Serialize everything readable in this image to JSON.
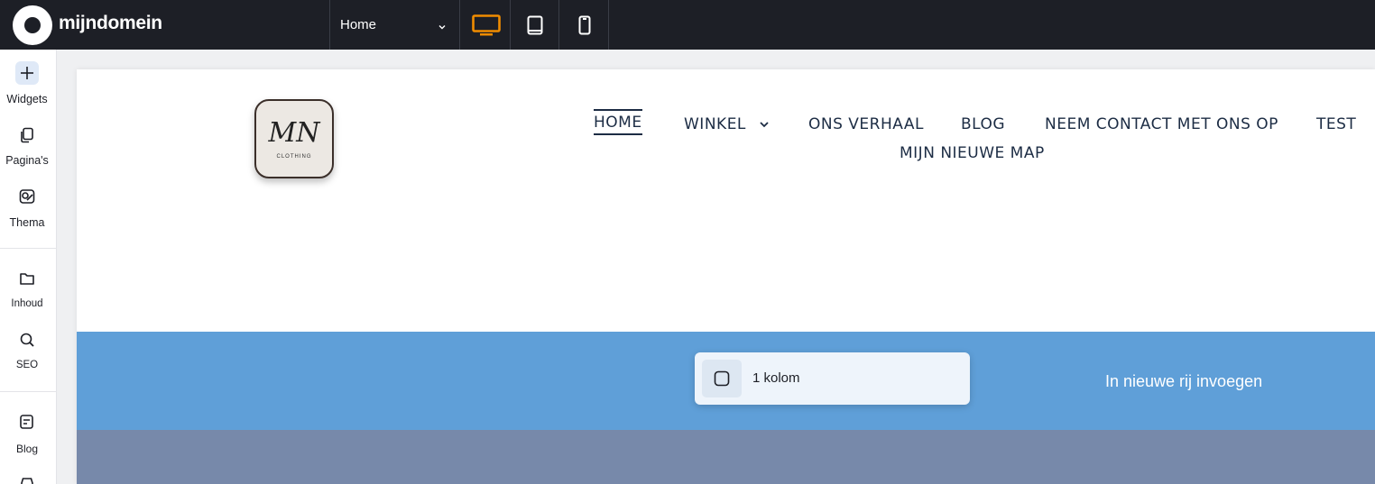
{
  "brand": {
    "name": "mijndomein"
  },
  "topbar": {
    "page_selector": {
      "value": "Home"
    },
    "devices": [
      {
        "name": "desktop",
        "active": true
      },
      {
        "name": "tablet",
        "active": false
      },
      {
        "name": "mobile",
        "active": false
      }
    ]
  },
  "sidebar": {
    "items": [
      {
        "label": "Widgets",
        "icon": "plus-icon"
      },
      {
        "label": "Pagina's",
        "icon": "pages-icon"
      },
      {
        "label": "Thema",
        "icon": "theme-icon"
      },
      {
        "label": "Inhoud",
        "icon": "folder-icon"
      },
      {
        "label": "SEO",
        "icon": "seo-search-icon"
      },
      {
        "label": "Blog",
        "icon": "blog-icon"
      }
    ]
  },
  "site": {
    "logo": {
      "monogram": "MN",
      "subtitle": "CLOTHING"
    },
    "nav": {
      "home": "HOME",
      "winkel": "WINKEL",
      "ons_verhaal": "ONS VERHAAL",
      "blog": "BLOG",
      "contact": "NEEM CONTACT MET ONS OP",
      "test": "TEST",
      "map": "MIJN NIEUWE MAP"
    }
  },
  "popover": {
    "option_label": "1 kolom"
  },
  "row_action": {
    "label": "In nieuwe rij invoegen"
  },
  "colors": {
    "topbar": "#1d1f26",
    "accent": "#f08c00",
    "nav_text": "#1c2c44",
    "blue_row": "#5f9fd8",
    "gray_row": "#7789aa"
  }
}
